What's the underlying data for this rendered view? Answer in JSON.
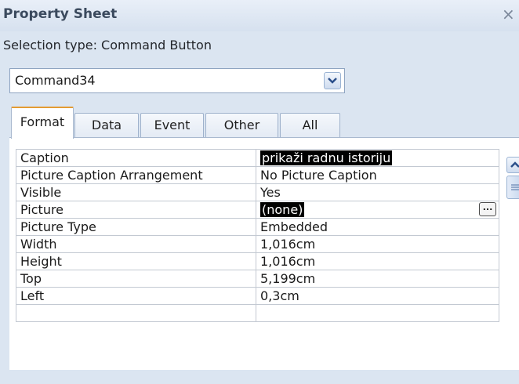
{
  "window": {
    "title": "Property Sheet",
    "close_glyph": "×"
  },
  "selection_type": "Selection type:  Command Button",
  "object_combo": {
    "value": "Command34",
    "dropdown_icon": "chevron-down-icon"
  },
  "tabs": [
    {
      "label": "Format",
      "active": true
    },
    {
      "label": "Data",
      "active": false
    },
    {
      "label": "Event",
      "active": false
    },
    {
      "label": "Other",
      "active": false
    },
    {
      "label": "All",
      "active": false
    }
  ],
  "properties": [
    {
      "name": "Caption",
      "value": "prikaži radnu istoriju",
      "highlighted": true
    },
    {
      "name": "Picture Caption Arrangement",
      "value": "No Picture Caption"
    },
    {
      "name": "Visible",
      "value": "Yes"
    },
    {
      "name": "Picture",
      "value": "(none)",
      "highlighted": true,
      "has_builder": true,
      "builder_label": "..."
    },
    {
      "name": "Picture Type",
      "value": "Embedded"
    },
    {
      "name": "Width",
      "value": "1,016cm"
    },
    {
      "name": "Height",
      "value": "1,016cm"
    },
    {
      "name": "Top",
      "value": "5,199cm"
    },
    {
      "name": "Left",
      "value": "0,3cm"
    }
  ],
  "colors": {
    "background": "#dbe5f1",
    "active_tab_accent": "#e49b32",
    "highlight": "#000000"
  }
}
